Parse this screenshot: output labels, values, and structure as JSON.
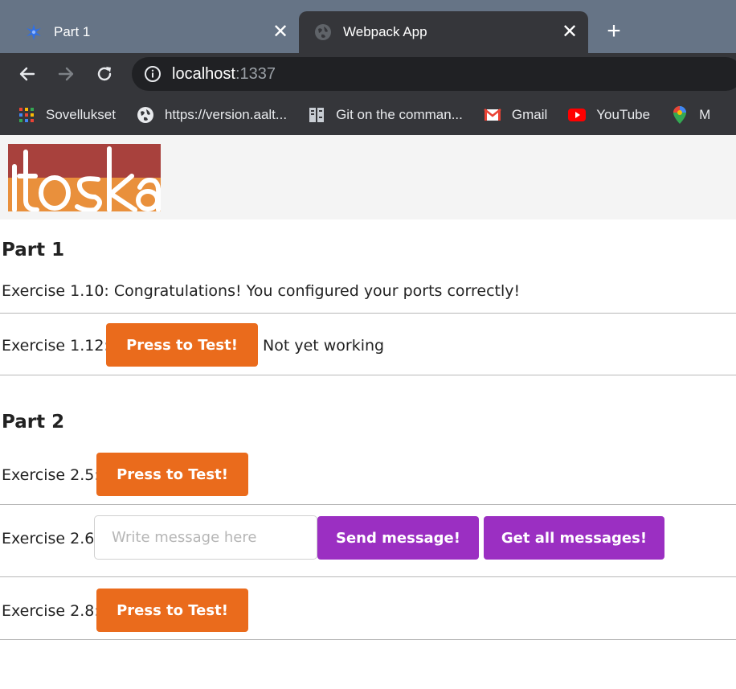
{
  "browser": {
    "tabs": [
      {
        "title": "Part 1",
        "active": false,
        "icon": "blue-star-icon"
      },
      {
        "title": "Webpack App",
        "active": true,
        "icon": "globe-icon"
      }
    ],
    "close_glyph": "✕",
    "new_tab_glyph": "+",
    "url": {
      "host": "localhost",
      "port": ":1337"
    },
    "bookmarks": [
      {
        "label": "Sovellukset",
        "icon": "apps-grid-icon"
      },
      {
        "label": "https://version.aalt...",
        "icon": "globe-icon"
      },
      {
        "label": "Git on the comman...",
        "icon": "git-book-icon"
      },
      {
        "label": "Gmail",
        "icon": "gmail-icon"
      },
      {
        "label": "YouTube",
        "icon": "youtube-icon"
      },
      {
        "label": "M",
        "icon": "maps-pin-icon"
      }
    ]
  },
  "colors": {
    "tabstrip": "#667486",
    "toolbar": "#35363a",
    "orange_button": "#ea6b1c",
    "purple_button": "#9b2fc2"
  },
  "page": {
    "logo_alt": "itoska",
    "part1": {
      "heading": "Part 1",
      "ex110": "Exercise 1.10: Congratulations! You configured your ports correctly!",
      "ex112_label": "Exercise 1.12:",
      "ex112_button": "Press to Test!",
      "ex112_status": "Not yet working"
    },
    "part2": {
      "heading": "Part 2",
      "ex25_label": "Exercise 2.5:",
      "ex25_button": "Press to Test!",
      "ex26_label": "Exercise 2.6:",
      "ex26_placeholder": "Write message here",
      "ex26_send": "Send message!",
      "ex26_getall": "Get all messages!",
      "ex28_label": "Exercise 2.8:",
      "ex28_button": "Press to Test!"
    }
  }
}
